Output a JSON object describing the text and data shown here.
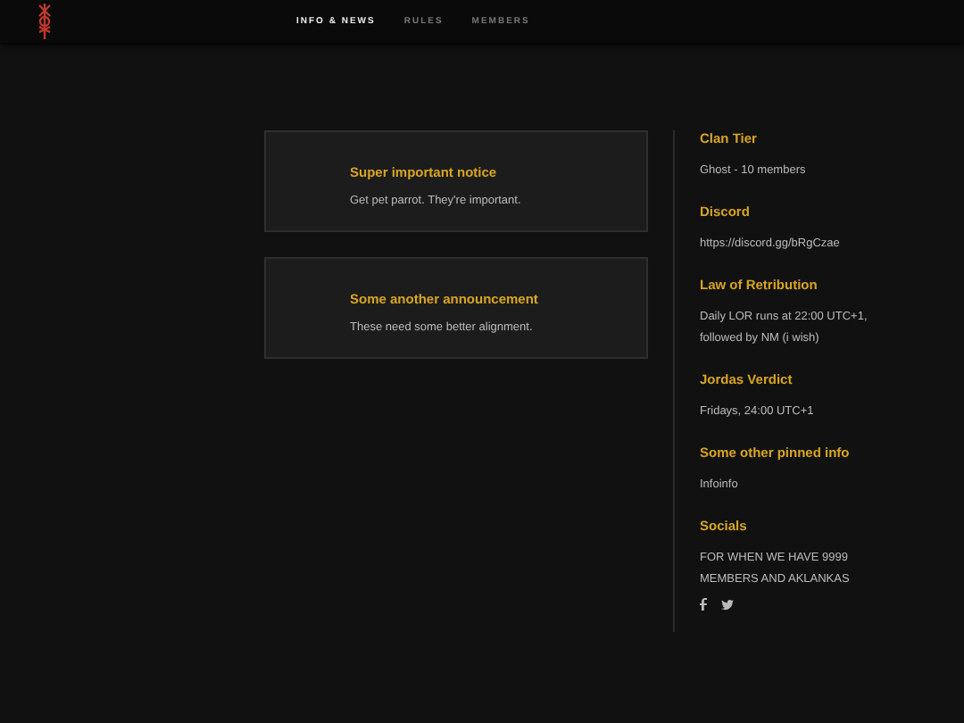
{
  "nav": [
    {
      "label": "INFO & NEWS",
      "selected": true
    },
    {
      "label": "RULES",
      "selected": false
    },
    {
      "label": "MEMBERS",
      "selected": false
    }
  ],
  "announcements": [
    {
      "title": "Super important notice",
      "body": "Get pet parrot. They're important."
    },
    {
      "title": "Some another announcement",
      "body": "These need some better alignment."
    }
  ],
  "sidebar": [
    {
      "heading": "Clan Tier",
      "text": "Ghost - 10 members"
    },
    {
      "heading": "Discord",
      "text": "https://discord.gg/bRgCzae"
    },
    {
      "heading": "Law of Retribution",
      "text": "Daily LOR runs at 22:00 UTC+1, followed by NM (i wish)"
    },
    {
      "heading": "Jordas Verdict",
      "text": "Fridays, 24:00 UTC+1"
    },
    {
      "heading": "Some other pinned info",
      "text": "Infoinfo"
    },
    {
      "heading": "Socials",
      "text": "FOR WHEN WE HAVE 9999 MEMBERS AND AKLANKAS",
      "social_links": [
        {
          "kind": "facebook"
        },
        {
          "kind": "twitter"
        }
      ]
    }
  ]
}
